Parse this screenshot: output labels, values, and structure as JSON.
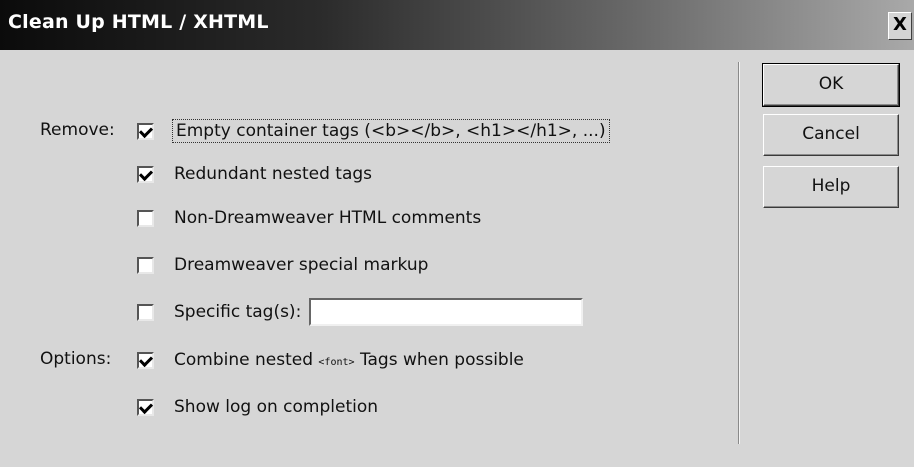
{
  "window": {
    "title": "Clean Up HTML / XHTML",
    "close_label": "X"
  },
  "remove_label": "Remove:",
  "options_label": "Options:",
  "remove_items": [
    {
      "label": "Empty container tags (<b></b>, <h1></h1>, ...)",
      "checked": true
    },
    {
      "label": "Redundant nested tags",
      "checked": true
    },
    {
      "label": "Non-Dreamweaver HTML comments",
      "checked": false
    },
    {
      "label": "Dreamweaver special markup",
      "checked": false
    },
    {
      "label": "Specific tag(s):",
      "checked": false,
      "input_value": ""
    }
  ],
  "option_items": [
    {
      "label_pre": "Combine nested",
      "label_code": "<font>",
      "label_post": "Tags when possible",
      "checked": true
    },
    {
      "label": "Show log on completion",
      "checked": true
    }
  ],
  "buttons": {
    "ok": "OK",
    "cancel": "Cancel",
    "help": "Help"
  }
}
